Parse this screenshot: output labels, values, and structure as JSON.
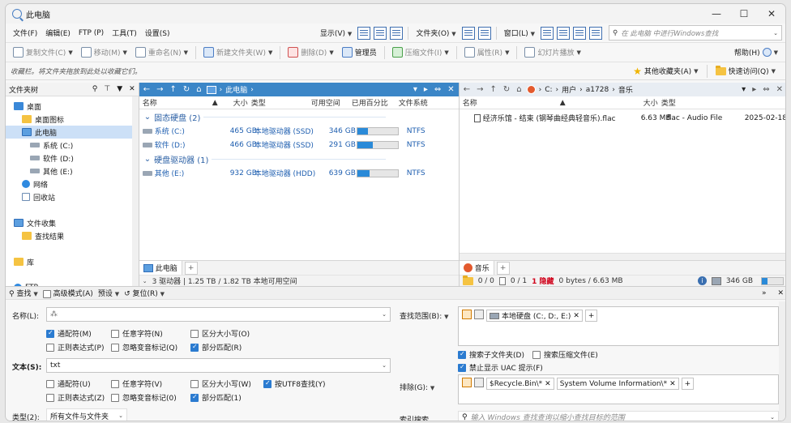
{
  "window": {
    "title": "此电脑",
    "controls": {
      "minimize": "—",
      "maximize": "☐",
      "close": "✕"
    }
  },
  "menu": {
    "items": [
      "文件(F)",
      "编辑(E)",
      "FTP (P)",
      "工具(T)",
      "设置(S)"
    ],
    "display": "显示(V)",
    "folder": "文件夹(O)",
    "window": "窗口(L)",
    "search_placeholder": "在 此电脑 中进行Windows查找"
  },
  "toolbar": {
    "copy": "复制文件(C)",
    "move": "移动(M)",
    "rename": "重命名(N)",
    "new_folder": "新建文件夹(W)",
    "delete": "删除(D)",
    "admin": "管理员",
    "compress": "压缩文件(I)",
    "properties": "属性(R)",
    "slideshow": "幻灯片播放",
    "help": "帮助(H)"
  },
  "favbar": {
    "hint": "收藏栏。将文件夹拖放到此处以收藏它们。",
    "other_favorites": "其他收藏夹(A)",
    "quick_access": "快速访问(Q)"
  },
  "tree": {
    "header": "文件夹树",
    "items": [
      {
        "label": "桌面",
        "icon": "desktop-icon",
        "indent": 0
      },
      {
        "label": "桌面图标",
        "icon": "folder-icon",
        "indent": 1
      },
      {
        "label": "此电脑",
        "icon": "computer-icon",
        "indent": 1,
        "selected": true
      },
      {
        "label": "系统 (C:)",
        "icon": "drive-icon",
        "indent": 2
      },
      {
        "label": "软件 (D:)",
        "icon": "drive-icon",
        "indent": 2
      },
      {
        "label": "其他 (E:)",
        "icon": "drive-icon",
        "indent": 2
      },
      {
        "label": "网络",
        "icon": "network-icon",
        "indent": 1
      },
      {
        "label": "回收站",
        "icon": "recycle-bin-icon",
        "indent": 1
      },
      {
        "label": "",
        "icon": "",
        "indent": 0
      },
      {
        "label": "文件收集",
        "icon": "collection-icon",
        "indent": 0
      },
      {
        "label": "查找结果",
        "icon": "search-results-icon",
        "indent": 1
      },
      {
        "label": "",
        "icon": "",
        "indent": 0
      },
      {
        "label": "库",
        "icon": "library-icon",
        "indent": 0
      },
      {
        "label": "",
        "icon": "",
        "indent": 0
      },
      {
        "label": "FTP",
        "icon": "ftp-icon",
        "indent": 0
      }
    ]
  },
  "left_pane": {
    "path": [
      "此电脑"
    ],
    "columns": [
      "名称",
      "大小",
      "类型",
      "可用空间",
      "已用百分比",
      "文件系统"
    ],
    "groups": [
      {
        "title": "固态硬盘 (2)",
        "drives": [
          {
            "name": "系统 (C:)",
            "size": "465 GB",
            "type": "本地驱动器 (SSD)",
            "free": "346 GB",
            "used_pct": 26,
            "fs": "NTFS"
          },
          {
            "name": "软件 (D:)",
            "size": "466 GB",
            "type": "本地驱动器 (SSD)",
            "free": "291 GB",
            "used_pct": 38,
            "fs": "NTFS"
          }
        ]
      },
      {
        "title": "硬盘驱动器 (1)",
        "drives": [
          {
            "name": "其他 (E:)",
            "size": "932 GB",
            "type": "本地驱动器 (HDD)",
            "free": "639 GB",
            "used_pct": 31,
            "fs": "NTFS"
          }
        ]
      }
    ],
    "tab": "此电脑",
    "status": "3 驱动器 | 1.25 TB / 1.82 TB 本地可用空间"
  },
  "right_pane": {
    "path": [
      "C:",
      "用户",
      "a1728",
      "音乐"
    ],
    "columns": [
      "名称",
      "大小",
      "类型",
      ""
    ],
    "files": [
      {
        "name": "经济乐馆 - 结束 (钢琴曲经典轻音乐).flac",
        "size": "6.63 MB",
        "type": "flac - Audio File",
        "date": "2025-02-18"
      }
    ],
    "tab": "音乐",
    "status": {
      "folders": "0 / 0",
      "files": "0 / 1",
      "hidden": "1 隐藏",
      "bytes": "0 bytes / 6.63 MB",
      "free": "346 GB"
    }
  },
  "find": {
    "toolbar": {
      "search": "查找",
      "advanced": "高级模式(A)",
      "preset": "预设",
      "reset": "复位(R)"
    },
    "name_label": "名称(L):",
    "name_value": "",
    "name_options": [
      {
        "label": "通配符(M)",
        "checked": true
      },
      {
        "label": "任意字符(N)",
        "checked": false
      },
      {
        "label": "区分大小写(O)",
        "checked": false
      },
      {
        "label": "正则表达式(P)",
        "checked": false
      },
      {
        "label": "忽略变音标记(Q)",
        "checked": false
      },
      {
        "label": "部分匹配(R)",
        "checked": true
      }
    ],
    "text_label": "文本(S):",
    "text_value": "txt",
    "text_options": [
      {
        "label": "通配符(U)",
        "checked": false
      },
      {
        "label": "任意字符(V)",
        "checked": false
      },
      {
        "label": "区分大小写(W)",
        "checked": false
      },
      {
        "label": "按UTF8查找(Y)",
        "checked": true
      },
      {
        "label": "正则表达式(Z)",
        "checked": false
      },
      {
        "label": "忽略变音标记(0)",
        "checked": false
      },
      {
        "label": "部分匹配(1)",
        "checked": true
      }
    ],
    "type_label": "类型(2):",
    "type_value": "所有文件与文件夹",
    "scope_label": "查找范围(B):",
    "scope_chip": "本地硬盘 (C:, D:, E:)",
    "scope_options": [
      {
        "label": "搜索子文件夹(D)",
        "checked": true
      },
      {
        "label": "搜索压缩文件(E)",
        "checked": false
      },
      {
        "label": "禁止显示 UAC 提示(F)",
        "checked": true
      }
    ],
    "exclude_label": "排除(G):",
    "exclude_chips": [
      "$Recycle.Bin\\*",
      "System Volume Information\\*"
    ],
    "index_label": "索引搜索",
    "index_placeholder": "输入 Windows 查找查询以缩小查找目标的范围"
  }
}
